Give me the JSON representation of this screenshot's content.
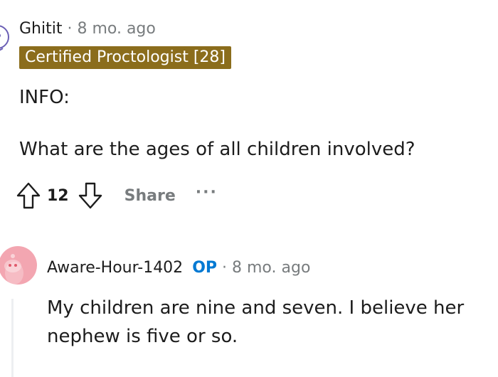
{
  "comment": {
    "author": "Ghitit",
    "separator": "·",
    "time": "8 mo. ago",
    "flair": "Certified Proctologist [28]",
    "lines": [
      "INFO:",
      "What are the ages of all children involved?"
    ],
    "votes": "12",
    "share_label": "Share",
    "more_label": "···"
  },
  "reply": {
    "author": "Aware-Hour-1402",
    "op_badge": "OP",
    "separator": "·",
    "time": "8 mo. ago",
    "text": "My children are nine and seven. I believe her nephew is five or so."
  },
  "colors": {
    "flair_bg": "#8b6d1c",
    "op_blue": "#0079d3",
    "avatar_pink": "#f3a6b1",
    "muted": "#787c7e"
  }
}
